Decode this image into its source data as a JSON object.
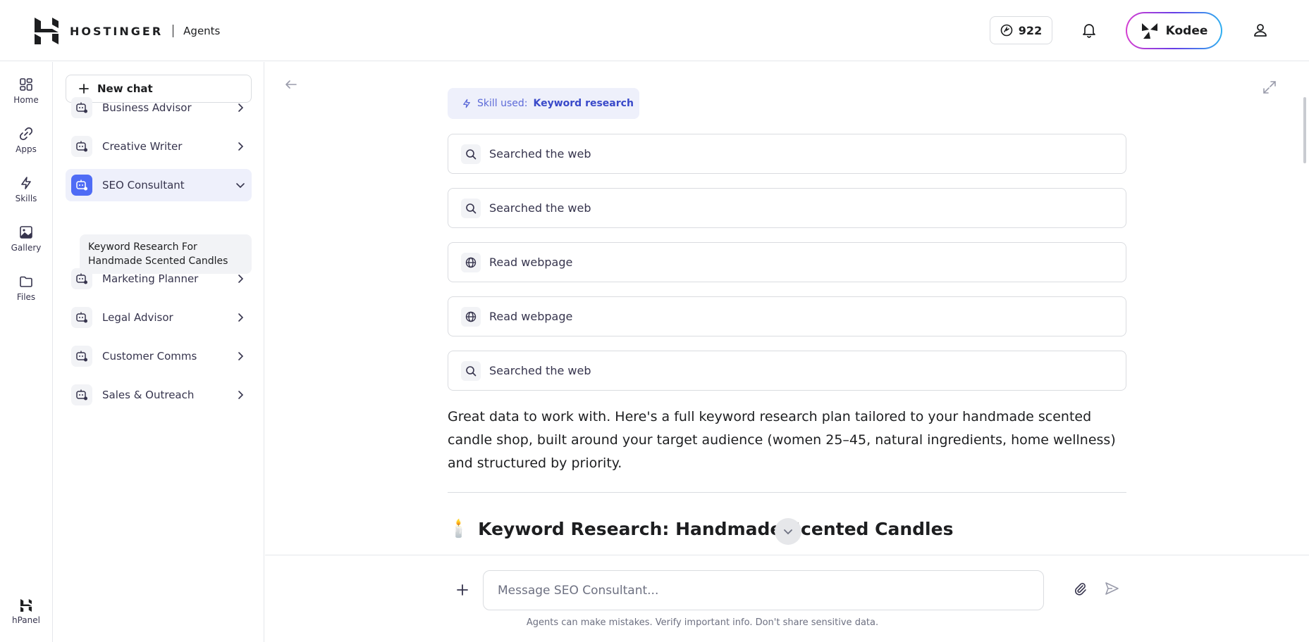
{
  "header": {
    "brand_name": "HOSTINGER",
    "brand_sub": "Agents",
    "credits": "922",
    "kodee_label": "Kodee"
  },
  "rail": {
    "items": [
      {
        "label": "Home",
        "icon": "home-grid-icon"
      },
      {
        "label": "Apps",
        "icon": "link-icon"
      },
      {
        "label": "Skills",
        "icon": "lightning-icon"
      },
      {
        "label": "Gallery",
        "icon": "image-icon"
      },
      {
        "label": "Files",
        "icon": "folder-icon"
      }
    ],
    "bottom_label": "hPanel"
  },
  "sidebar": {
    "new_chat_label": "New chat",
    "agents": [
      {
        "label": "Business Advisor",
        "expanded": false
      },
      {
        "label": "Creative Writer",
        "expanded": false
      },
      {
        "label": "SEO Consultant",
        "expanded": true
      },
      {
        "label": "Marketing Planner",
        "expanded": false
      },
      {
        "label": "Legal Advisor",
        "expanded": false
      },
      {
        "label": "Customer Comms",
        "expanded": false
      },
      {
        "label": "Sales & Outreach",
        "expanded": false
      }
    ],
    "active_chat": "Keyword Research For Handmade Scented Candles"
  },
  "chat": {
    "skill_prefix": "Skill used:",
    "skill_name": "Keyword research",
    "steps": [
      {
        "label": "Searched the web",
        "icon": "search-icon"
      },
      {
        "label": "Searched the web",
        "icon": "search-icon"
      },
      {
        "label": "Read webpage",
        "icon": "globe-icon"
      },
      {
        "label": "Read webpage",
        "icon": "globe-icon"
      },
      {
        "label": "Searched the web",
        "icon": "search-icon"
      }
    ],
    "answer": "Great data to work with. Here's a full keyword research plan tailored to your handmade scented candle shop, built around your target audience (women 25–45, natural ingredients, home wellness) and structured by priority.",
    "heading_emoji": "🕯️",
    "heading": "Keyword Research: Handmade Scented Candles"
  },
  "composer": {
    "placeholder": "Message SEO Consultant...",
    "disclaimer": "Agents can make mistakes. Verify important info. Don't share sensitive data."
  },
  "colors": {
    "accent": "#4f6cf5",
    "active_bg": "#eef0fb",
    "border": "#dadce0"
  }
}
